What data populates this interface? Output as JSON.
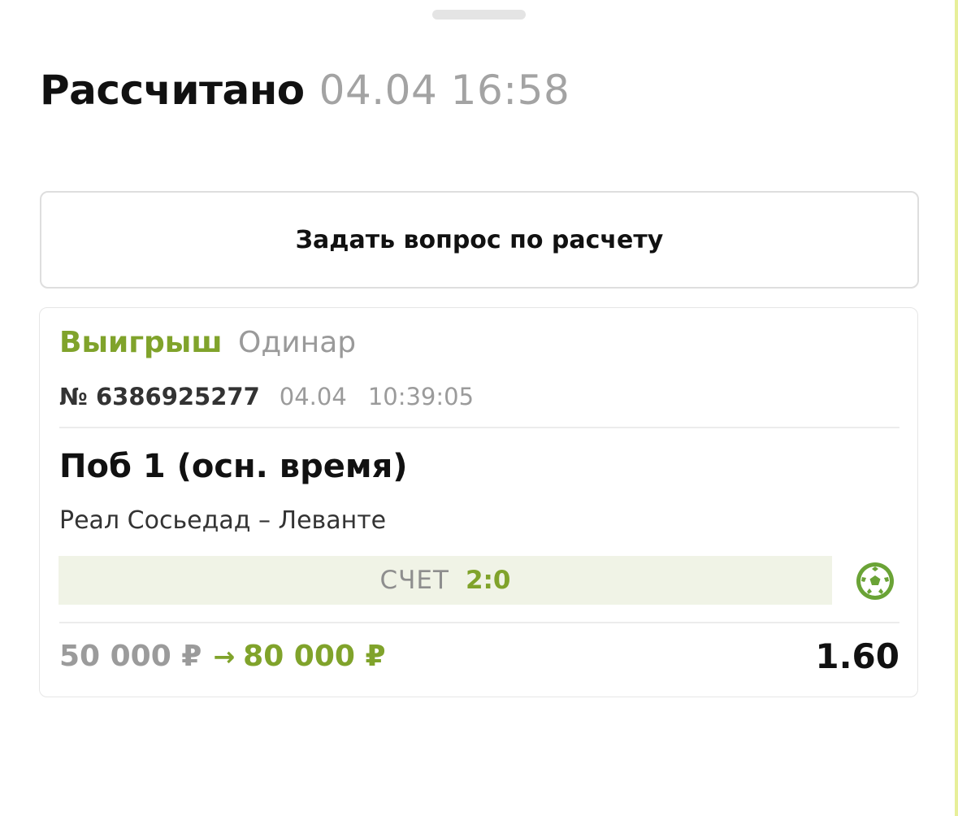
{
  "header": {
    "status": "Рассчитано",
    "time": "04.04 16:58"
  },
  "ask_button": {
    "label": "Задать вопрос по расчету"
  },
  "bet": {
    "result": "Выигрыш",
    "type": "Одинар",
    "number": "№ 6386925277",
    "date": "04.04",
    "time": "10:39:05",
    "selection": "Поб 1 (осн. время)",
    "event": "Реал Сосьедад – Леванте",
    "score_label": "СЧЕТ",
    "score": "2:0",
    "sport_icon": "soccer-ball-icon",
    "stake": "50 000 ₽",
    "arrow": "→",
    "payout": "80 000 ₽",
    "odds": "1.60"
  },
  "colors": {
    "accent": "#80a32b",
    "muted": "#9b9b9b",
    "score_bg": "#f0f3e6"
  }
}
